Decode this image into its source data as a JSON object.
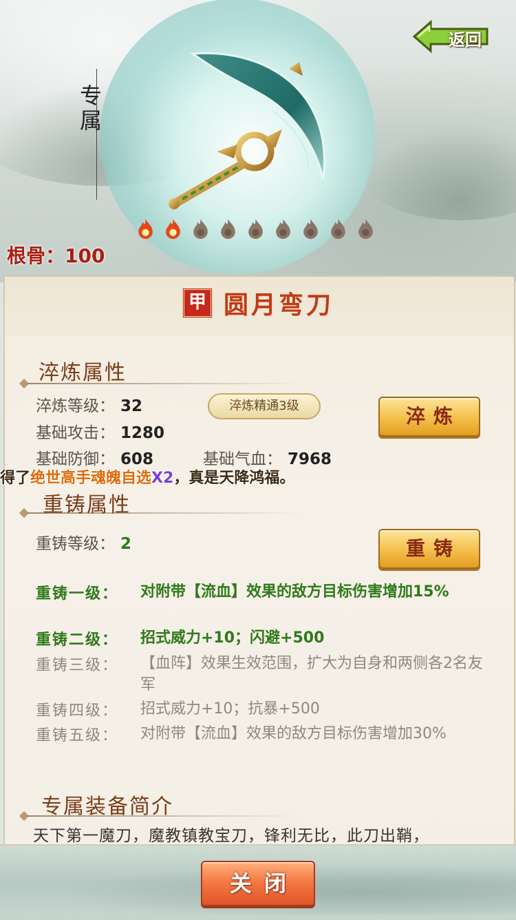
{
  "header": {
    "vertical_title": "专属",
    "back_label": "返回",
    "bone_label": "根骨：",
    "bone_value": "100",
    "flames_lit": 2,
    "flames_total": 9
  },
  "item": {
    "grade": "甲",
    "name": "圆月弯刀"
  },
  "refine": {
    "section_title": "淬炼属性",
    "level_label": "淬炼等级：",
    "level_value": "32",
    "atk_label": "基础攻击：",
    "atk_value": "1280",
    "def_label": "基础防御：",
    "def_value": "608",
    "hp_label": "基础气血：",
    "hp_value": "7968",
    "mastery": "淬炼精通3级",
    "button_label": "淬炼"
  },
  "marquee": {
    "prefix": "得了",
    "highlight": "绝世高手魂魄自选",
    "multiplier": "X2",
    "suffix": "，真是天降鸿福。"
  },
  "recast": {
    "section_title": "重铸属性",
    "level_label": "重铸等级：",
    "level_value": "2",
    "button_label": "重铸",
    "tiers": [
      {
        "label": "重铸一级：",
        "text": "对附带【流血】效果的敌方目标伤害增加15%"
      },
      {
        "label": "重铸二级：",
        "text": "招式威力+10；闪避+500"
      },
      {
        "label": "重铸三级：",
        "text": "【血阵】效果生效范围，扩大为自身和两侧各2名友军"
      },
      {
        "label": "重铸四级：",
        "text": "招式威力+10；抗暴+500"
      },
      {
        "label": "重铸五级：",
        "text": "对附带【流血】效果的敌方目标伤害增加30%"
      }
    ]
  },
  "intro": {
    "section_title": "专属装备简介",
    "text": "天下第一魔刀，魔教镇教宝刀，锋利无比，此刀出鞘，"
  },
  "footer": {
    "close_label": "关闭"
  },
  "colors": {
    "accent_red": "#c23a14",
    "active_green": "#2f7a1b",
    "inactive_gray": "#8d8882",
    "gold_button": "#f4bf4a",
    "close_button": "#f2763f"
  }
}
